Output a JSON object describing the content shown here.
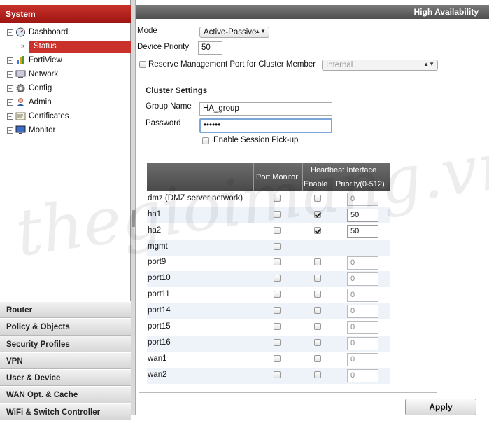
{
  "sidebar": {
    "section_title": "System",
    "tree": [
      {
        "label": "Dashboard",
        "icon": "dashboard-icon"
      },
      {
        "label": "FortiView",
        "icon": "bar-chart-icon"
      },
      {
        "label": "Network",
        "icon": "network-icon"
      },
      {
        "label": "Config",
        "icon": "config-gear-icon"
      },
      {
        "label": "Admin",
        "icon": "admin-user-icon"
      },
      {
        "label": "Certificates",
        "icon": "certificate-icon"
      },
      {
        "label": "Monitor",
        "icon": "monitor-icon"
      }
    ],
    "status_label": "Status",
    "bottom_nav": [
      "Router",
      "Policy & Objects",
      "Security Profiles",
      "VPN",
      "User & Device",
      "WAN Opt. & Cache",
      "WiFi & Switch Controller"
    ]
  },
  "header": {
    "title": "High Availability"
  },
  "form": {
    "mode_label": "Mode",
    "mode_value": "Active-Passive",
    "priority_label": "Device Priority",
    "priority_value": "50",
    "reserve_label": "Reserve Management Port for Cluster Member",
    "reserve_value": "Internal"
  },
  "cluster": {
    "legend": "Cluster Settings",
    "group_label": "Group Name",
    "group_value": "HA_group",
    "password_label": "Password",
    "password_value": "••••••",
    "session_label": "Enable Session Pick-up"
  },
  "table": {
    "col_port_monitor": "Port Monitor",
    "col_heartbeat": "Heartbeat Interface",
    "col_enable": "Enable",
    "col_priority": "Priority(0-512)",
    "rows": [
      {
        "name": "dmz (DMZ server network)",
        "monitor": false,
        "enable": false,
        "priority": "0"
      },
      {
        "name": "ha1",
        "monitor": false,
        "enable": true,
        "priority": "50"
      },
      {
        "name": "ha2",
        "monitor": false,
        "enable": true,
        "priority": "50"
      },
      {
        "name": "mgmt",
        "monitor": false,
        "enable": null,
        "priority": null
      },
      {
        "name": "port9",
        "monitor": false,
        "enable": false,
        "priority": "0"
      },
      {
        "name": "port10",
        "monitor": false,
        "enable": false,
        "priority": "0"
      },
      {
        "name": "port11",
        "monitor": false,
        "enable": false,
        "priority": "0"
      },
      {
        "name": "port14",
        "monitor": false,
        "enable": false,
        "priority": "0"
      },
      {
        "name": "port15",
        "monitor": false,
        "enable": false,
        "priority": "0"
      },
      {
        "name": "port16",
        "monitor": false,
        "enable": false,
        "priority": "0"
      },
      {
        "name": "wan1",
        "monitor": false,
        "enable": false,
        "priority": "0"
      },
      {
        "name": "wan2",
        "monitor": false,
        "enable": false,
        "priority": "0"
      }
    ]
  },
  "apply_label": "Apply",
  "watermark": "thegioimang.vn",
  "colors": {
    "accent": "#c8322b",
    "header_dark": "#4f4f4f"
  }
}
